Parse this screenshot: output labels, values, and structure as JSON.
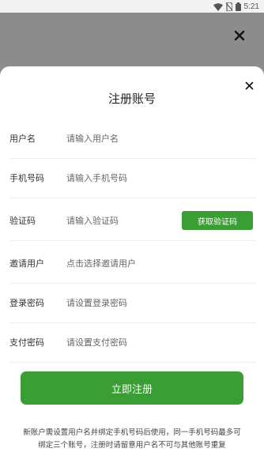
{
  "status_bar": {
    "time": "5:21",
    "icons": [
      "wifi-icon",
      "no-sim-icon",
      "battery-icon"
    ]
  },
  "background": {
    "close_icon": "close-icon"
  },
  "dialog": {
    "title": "注册账号",
    "close_icon": "close-icon",
    "fields": [
      {
        "label": "用户名",
        "placeholder": "请输入用户名",
        "value": ""
      },
      {
        "label": "手机号码",
        "placeholder": "请输入手机号码",
        "value": ""
      },
      {
        "label": "验证码",
        "placeholder": "请输入验证码",
        "value": ""
      },
      {
        "label": "邀请用户",
        "placeholder": "点击选择邀请用户",
        "value": ""
      },
      {
        "label": "登录密码",
        "placeholder": "请设置登录密码",
        "value": ""
      },
      {
        "label": "支付密码",
        "placeholder": "请设置支付密码",
        "value": ""
      }
    ],
    "get_code_button": "获取验证码",
    "submit_button": "立即注册",
    "notice_lines": [
      "新账户需设置用户名并绑定手机号码后使用，同一手机号码最多可",
      "绑定三个账号，注册时请留意用户名不可与其他账号重复"
    ]
  },
  "colors": {
    "accent": "#3a9e34",
    "overlay": "#8c8c8c",
    "sheet": "#ffffff"
  }
}
